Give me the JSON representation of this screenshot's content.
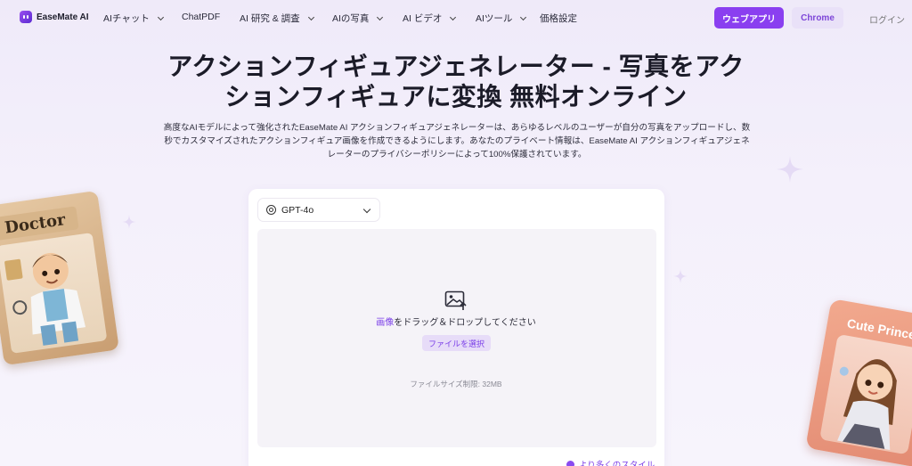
{
  "nav": {
    "logo_text": "EaseMate AI",
    "items": [
      {
        "label": "AIチャット",
        "dropdown": true
      },
      {
        "label": "ChatPDF",
        "dropdown": false
      },
      {
        "label": "AI 研究 & 調査",
        "dropdown": true
      },
      {
        "label": "AIの写真",
        "dropdown": true
      },
      {
        "label": "AI ビデオ",
        "dropdown": true
      },
      {
        "label": "AIツール",
        "dropdown": true
      },
      {
        "label": "価格設定",
        "dropdown": false
      }
    ],
    "web_app_label": "ウェブアプリ",
    "chrome_label": "Chrome",
    "login_label": "ログイン"
  },
  "hero": {
    "title_line1": "アクションフィギュアジェネレーター - 写真をアク",
    "title_line2": "ションフィギュアに変換 無料オンライン",
    "description_line1": "高度なAIモデルによって強化されたEaseMate AI アクションフィギュアジェネレーターは、あらゆるレベルのユーザーが自分の写真をアップロードし、数",
    "description_line2": "秒でカスタマイズされたアクションフィギュア画像を作成できるようにします。あなたのプライベート情報は、EaseMate AI アクションフィギュアジェネ",
    "description_line3": "レーターのプライバシーポリシーによって100%保護されています。"
  },
  "upload": {
    "model_selected": "GPT-4o",
    "drag_link": "画像",
    "drag_text": "をドラッグ＆ドロップしてください",
    "choose_file_label": "ファイルを選択",
    "size_limit": "ファイルサイズ制限: 32MB",
    "more_styles": "より多くのスタイル"
  },
  "decor": {
    "left_toy_label": "Doctor",
    "right_toy_label": "Cute Princess"
  },
  "colors": {
    "accent": "#8a3ff0",
    "accent_light": "#e7dcf8",
    "background": "#f4f0fb"
  }
}
